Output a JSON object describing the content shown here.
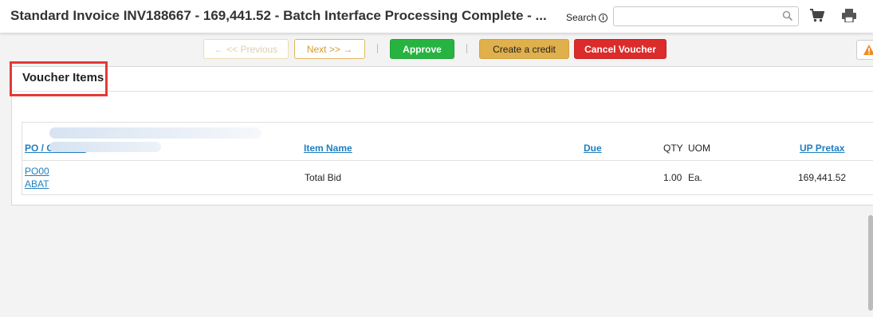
{
  "header": {
    "title": "Standard Invoice INV188667 - 169,441.52 - Batch Interface Processing Complete - ...",
    "search_label": "Search",
    "search_value": ""
  },
  "toolbar": {
    "previous_label": "← << Previous",
    "next_label": "Next >> →",
    "approve_label": "Approve",
    "create_credit_label": "Create a credit",
    "cancel_voucher_label": "Cancel Voucher"
  },
  "section": {
    "title": "Voucher Items"
  },
  "table": {
    "headers": {
      "po_contract": "PO / Contract",
      "item_name": "Item Name",
      "due": "Due",
      "qty": "QTY",
      "uom": "UOM",
      "up_pretax": "UP Pretax"
    },
    "rows": [
      {
        "po_line1": "PO00",
        "po_line2": "ABAT",
        "item_name": "Total Bid",
        "due": "",
        "qty": "1.00",
        "uom": "Ea.",
        "up_pretax": "169,441.52"
      }
    ]
  },
  "colors": {
    "approve": "#27b340",
    "create_credit": "#e0b04d",
    "cancel": "#dc2b2b",
    "link": "#1f7fc0",
    "highlight": "#e53935"
  },
  "icons": [
    "info-icon",
    "search-icon",
    "cart-icon",
    "print-icon",
    "warning-icon"
  ]
}
